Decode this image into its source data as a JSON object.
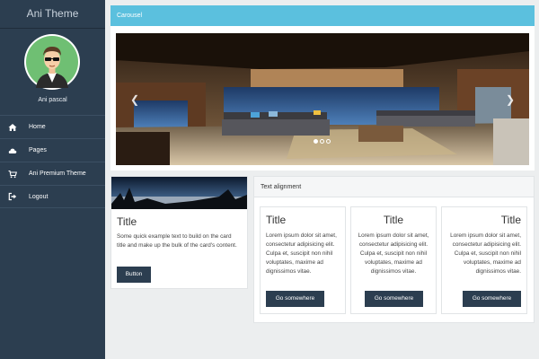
{
  "sidebar": {
    "brand": "Ani Theme",
    "user_name": "Ani pascal",
    "items": [
      {
        "label": "Home",
        "icon": "home-icon"
      },
      {
        "label": "Pages",
        "icon": "cloud-icon"
      },
      {
        "label": "Ani Premium Theme",
        "icon": "cart-icon"
      },
      {
        "label": "Logout",
        "icon": "logout-icon"
      }
    ]
  },
  "carousel": {
    "header": "Carousel",
    "indicators": 3,
    "active_index": 0
  },
  "title_card": {
    "title": "Title",
    "text": "Some quick example text to build on the card title and make up the bulk of the card's content.",
    "button": "Button"
  },
  "text_alignment": {
    "header": "Text alignment",
    "cards": [
      {
        "title": "Title",
        "text": "Lorem ipsum dolor sit amet, consectetur adipisicing elit. Culpa et, suscipit non nihil voluptates, maxime ad dignissimos vitae.",
        "button": "Go somewhere",
        "align": "left"
      },
      {
        "title": "Title",
        "text": "Lorem ipsum dolor sit amet, consectetur adipisicing elit. Culpa et, suscipit non nihil voluptates, maxime ad dignissimos vitae.",
        "button": "Go somewhere",
        "align": "center"
      },
      {
        "title": "Title",
        "text": "Lorem ipsum dolor sit amet, consectetur adipisicing elit. Culpa et, suscipit non nihil voluptates, maxime ad dignissimos vitae.",
        "button": "Go somewhere",
        "align": "right"
      }
    ]
  },
  "colors": {
    "sidebar_bg": "#2c3e50",
    "carousel_header": "#5bc0de",
    "button": "#2c3e50",
    "page_bg": "#eceeef"
  }
}
